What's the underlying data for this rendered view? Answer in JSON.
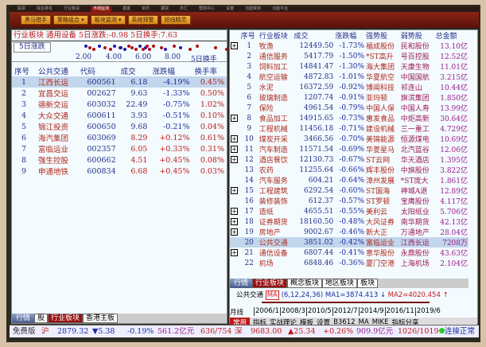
{
  "menu": [
    "股票",
    "综合排名",
    "行业板块",
    "市场监测",
    "基金",
    "资讯",
    "期货",
    "外汇",
    "帮助中心",
    "设置",
    "功能菜单",
    "功能平台"
  ],
  "toolbar": [
    "黑马猎手",
    "策略组合 ▾",
    "板块监测 ▾",
    "系统预警",
    "短线精灵"
  ],
  "left": {
    "header": "行业板块 通用设备 5日涨跌:-0.98 5日换手:7.63",
    "scatter_label": "5日涨跌",
    "ticks": [
      "2.00",
      "4.00",
      "6.00",
      "8.00",
      "5日换手"
    ],
    "columns": [
      "序号",
      "公共交通",
      "代码",
      "成交",
      "涨跌幅",
      "换手率"
    ],
    "rows": [
      [
        "1",
        "江西长运",
        "600561",
        "6.18",
        "-4.19%",
        "0.45%"
      ],
      [
        "2",
        "宜昌交运",
        "002627",
        "9.63",
        "-1.33%",
        "0.50%"
      ],
      [
        "3",
        "德新交运",
        "603032",
        "22.49",
        "-0.75%",
        "1.02%"
      ],
      [
        "4",
        "大众交通",
        "600611",
        "3.93",
        "-0.51%",
        "0.10%"
      ],
      [
        "5",
        "锦江投资",
        "600650",
        "9.68",
        "-0.21%",
        "0.04%"
      ],
      [
        "6",
        "海汽集团",
        "603069",
        "8.29",
        "+0.12%",
        "0.61%"
      ],
      [
        "7",
        "富临运业",
        "002357",
        "6.05",
        "+0.33%",
        "0.31%"
      ],
      [
        "8",
        "强生控股",
        "600662",
        "4.51",
        "+0.45%",
        "0.08%"
      ],
      [
        "9",
        "申通地铁",
        "600834",
        "6.68",
        "+0.45%",
        "0.03%"
      ]
    ],
    "tabs": [
      "行情",
      "股",
      "行业板块",
      "香港主板"
    ]
  },
  "right": {
    "columns": [
      "序号",
      "行业板块",
      "成交",
      "涨跌幅",
      "强势股",
      "弱势股",
      "总金额"
    ],
    "rows": [
      [
        "1",
        "牧渔",
        "12449.50",
        "-1.73%",
        "福成股份",
        "民和股份",
        "13.10亿",
        true
      ],
      [
        "2",
        "通信服务",
        "5417.79",
        "-1.50%",
        "*ST高升",
        "号百控股",
        "12.52亿",
        false
      ],
      [
        "3",
        "饲料加工",
        "14841.47",
        "-1.30%",
        "海大集团",
        "天康生物",
        "11.01亿",
        false
      ],
      [
        "4",
        "航空运输",
        "4872.83",
        "-1.01%",
        "华夏航空",
        "中国国航",
        "3.215亿",
        false
      ],
      [
        "5",
        "水泥",
        "16372.59",
        "-0.92%",
        "博闻科技",
        "祁连山",
        "10.44亿",
        false
      ],
      [
        "6",
        "玻璃制造",
        "1207.74",
        "-0.91%",
        "亚玛顿",
        "旗滨集团",
        "1.850亿",
        false
      ],
      [
        "7",
        "保险",
        "4961.54",
        "-0.79%",
        "中国人保",
        "中国人寿",
        "13.99亿",
        false
      ],
      [
        "8",
        "食品加工",
        "14915.65",
        "-0.73%",
        "惠发食品",
        "中炬高新",
        "30.64亿",
        true
      ],
      [
        "9",
        "工程机械",
        "11456.18",
        "-0.71%",
        "建设机械",
        "三一重工",
        "4.729亿",
        false
      ],
      [
        "10",
        "煤炭开采",
        "3466.56",
        "-0.70%",
        "美锦能源",
        "恒源煤电",
        "10.69亿",
        true
      ],
      [
        "11",
        "汽车制造",
        "11571.54",
        "-0.69%",
        "华菱星马",
        "北汽蓝谷",
        "12.06亿",
        true
      ],
      [
        "12",
        "酒店餐饮",
        "12130.73",
        "-0.67%",
        "ST云网",
        "华天酒店",
        "1.395亿",
        true
      ],
      [
        "13",
        "农药",
        "11255.64",
        "-0.66%",
        "辉丰股份",
        "中旗股份",
        "3.822亿",
        false
      ],
      [
        "14",
        "汽车服务",
        "604.21",
        "-0.64%",
        "漳州发展",
        "*ST庞大",
        "1.861亿",
        false
      ],
      [
        "15",
        "工程建筑",
        "6292.54",
        "-0.60%",
        "ST国海",
        "神城A退",
        "12.89亿",
        true
      ],
      [
        "16",
        "装修装饰",
        "612.37",
        "-0.57%",
        "ST罗顿",
        "宝鹰股份",
        "4.117亿",
        false
      ],
      [
        "17",
        "造纸",
        "4655.51",
        "-0.55%",
        "美利云",
        "太阳纸业",
        "5.706亿",
        true
      ],
      [
        "18",
        "证券期货",
        "18160.50",
        "-0.48%",
        "大风证券",
        "南华期货",
        "42.13亿",
        true
      ],
      [
        "19",
        "房地产",
        "9002.67",
        "-0.46%",
        "新大正",
        "万通地产",
        "28.04亿",
        true
      ],
      [
        "20",
        "公共交通",
        "3851.02",
        "-0.42%",
        "富临运业",
        "江西长运",
        "7208万",
        false
      ],
      [
        "21",
        "通信设备",
        "6807.44",
        "-0.41%",
        "意华股份",
        "永鼎股份",
        "43.63亿",
        true
      ],
      [
        "22",
        "机场",
        "6848.46",
        "-0.36%",
        "厦门空港",
        "上海机场",
        "2.104亿",
        false
      ]
    ],
    "tabs": [
      "行情",
      "行业板块",
      "概念板块",
      "地区板块",
      "板块"
    ],
    "kline": {
      "name": "公共交通",
      "ind": "MA",
      "params": "(6,12,24,36)",
      "ma1": "MA1=3874.413 ↓",
      "ma2": "MA2=4020.454 ↑",
      "dates": [
        "2006/1",
        "2008/3",
        "2010/5",
        "2012/7",
        "2014/9",
        "2016/11",
        "2019/6"
      ],
      "period": "月线",
      "bottom": [
        "常用",
        "指标",
        "实战理论",
        "模板",
        "设置",
        "B3612",
        "MA",
        "MIKE",
        "指标分享"
      ]
    }
  },
  "status": {
    "sh_label": "沪",
    "sh": "2879.32",
    "sh_chg": "▼5.38",
    "sh_pct": "-0.19%",
    "sh_amt": "561.2亿元",
    "sh_ud": "636/754",
    "sz_label": "深",
    "sz": "9683.00",
    "sz_chg": "▲25.34",
    "sz_pct": "+0.26%",
    "sz_amt": "909.9亿元",
    "sz_ud": "1026/1019",
    "conn": "连接正常",
    "brand": "免费版"
  }
}
